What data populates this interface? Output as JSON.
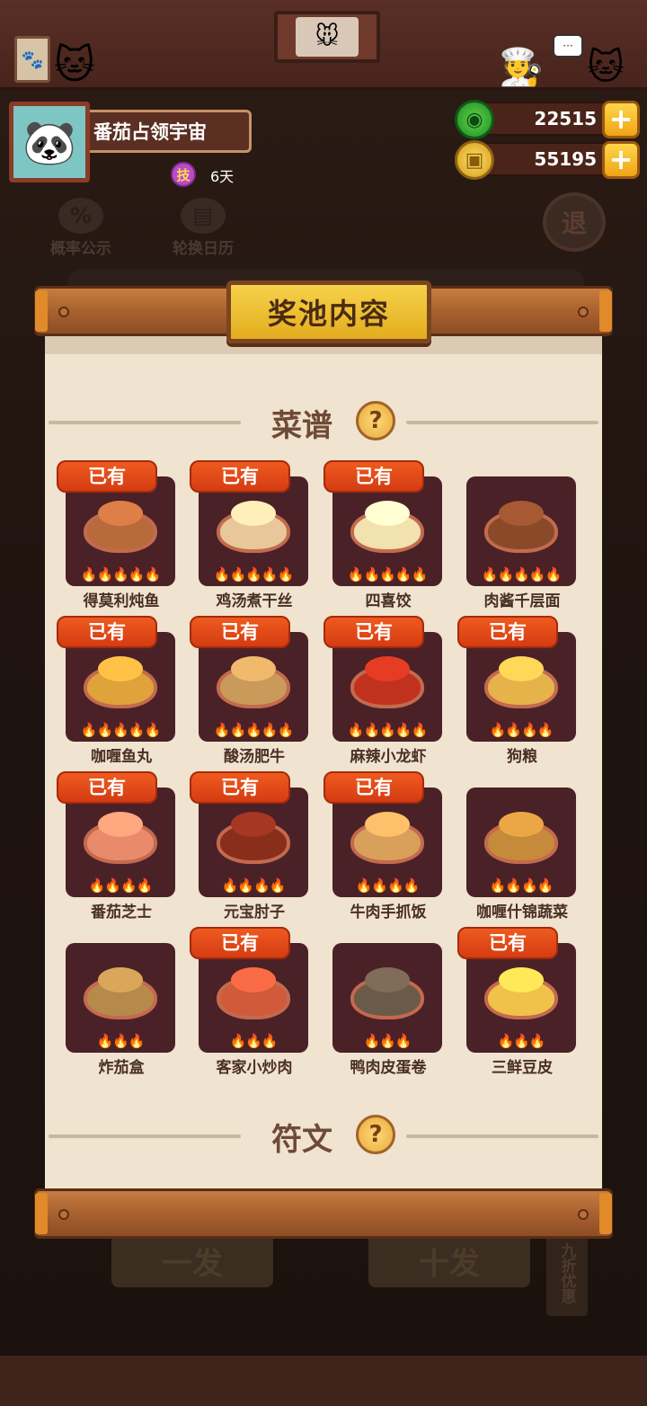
{
  "player": {
    "name": "番茄占领宇宙",
    "skill_badge": "技",
    "skill_days": "6天"
  },
  "currency": {
    "jade_value": "22515",
    "coin_value": "55195",
    "add_symbol": "+"
  },
  "background_buttons": {
    "probability": "概率公示",
    "calendar": "轮换日历",
    "exit": "退",
    "draw_one": "一发",
    "draw_ten": "十发",
    "discount": "九折优惠"
  },
  "modal": {
    "title": "奖池内容",
    "recipes_label": "菜谱",
    "runes_label": "符文",
    "help_symbol": "?",
    "owned_label": "已有"
  },
  "recipes": [
    {
      "name": "得莫利炖鱼",
      "owned": true,
      "flames": 5,
      "color": "#b86a3a"
    },
    {
      "name": "鸡汤煮干丝",
      "owned": true,
      "flames": 5,
      "color": "#e8c89a"
    },
    {
      "name": "四喜饺",
      "owned": true,
      "flames": 5,
      "color": "#f1e2b0"
    },
    {
      "name": "肉酱千层面",
      "owned": false,
      "flames": 5,
      "color": "#8a4a2a"
    },
    {
      "name": "咖喱鱼丸",
      "owned": true,
      "flames": 5,
      "color": "#e0a23a"
    },
    {
      "name": "酸汤肥牛",
      "owned": true,
      "flames": 5,
      "color": "#c99a5a"
    },
    {
      "name": "麻辣小龙虾",
      "owned": true,
      "flames": 5,
      "color": "#c0321e"
    },
    {
      "name": "狗粮",
      "owned": true,
      "flames": 4,
      "color": "#e6b34a"
    },
    {
      "name": "番茄芝士",
      "owned": true,
      "flames": 4,
      "color": "#e98b6a"
    },
    {
      "name": "元宝肘子",
      "owned": true,
      "flames": 4,
      "color": "#8a2e1c"
    },
    {
      "name": "牛肉手抓饭",
      "owned": true,
      "flames": 4,
      "color": "#d8a05a"
    },
    {
      "name": "咖喱什锦蔬菜",
      "owned": false,
      "flames": 4,
      "color": "#c58a3a"
    },
    {
      "name": "炸茄盒",
      "owned": false,
      "flames": 3,
      "color": "#b68a4a"
    },
    {
      "name": "客家小炒肉",
      "owned": true,
      "flames": 3,
      "color": "#d05a3a"
    },
    {
      "name": "鸭肉皮蛋卷",
      "owned": false,
      "flames": 3,
      "color": "#6a5a4a"
    },
    {
      "name": "三鲜豆皮",
      "owned": true,
      "flames": 3,
      "color": "#f0c24a"
    }
  ]
}
